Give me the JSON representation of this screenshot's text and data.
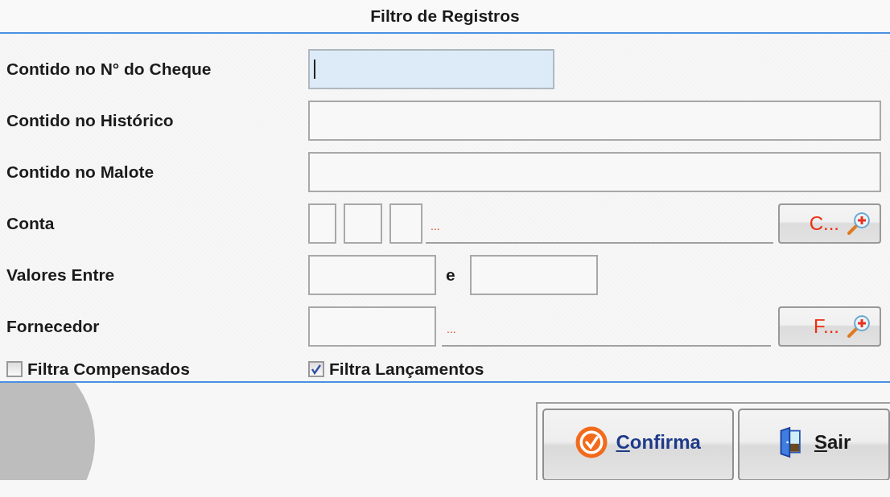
{
  "window": {
    "title": "Filtro de Registros"
  },
  "rows": [
    {
      "kind": "short",
      "label": "Contido no N° do Cheque",
      "focused": true
    },
    {
      "kind": "text",
      "label": "Contido no Histórico",
      "focused": false
    },
    {
      "kind": "text",
      "label": "Contido no Malote",
      "focused": false
    },
    {
      "kind": "account",
      "label": "Conta",
      "description": "...",
      "button": "C..."
    },
    {
      "kind": "range",
      "label": "Valores Entre",
      "separator": "e"
    },
    {
      "kind": "lookup",
      "label": "Fornecedor",
      "description": "...",
      "button": "F..."
    }
  ],
  "checkboxes": [
    {
      "label": "Filtra Compensados",
      "checked": false
    },
    {
      "label": "Filtra Lançamentos",
      "checked": true
    }
  ],
  "buttons": [
    {
      "kind": "confirm",
      "label": "Confirma"
    },
    {
      "kind": "exit",
      "label": "Sair"
    }
  ]
}
